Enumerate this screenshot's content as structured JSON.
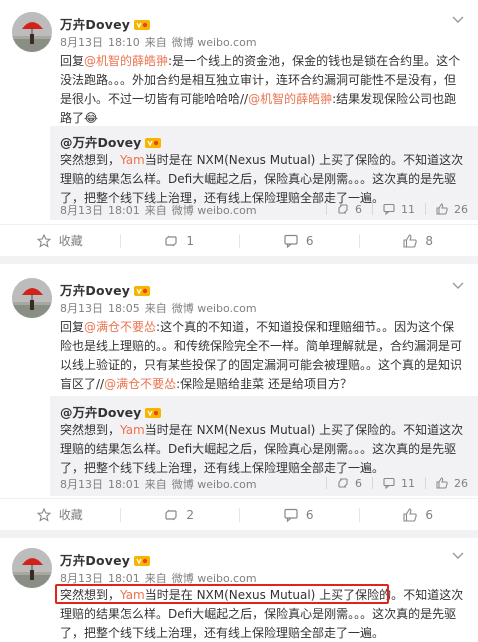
{
  "posts": [
    {
      "user": {
        "name": "万卉Dovey"
      },
      "meta": {
        "date": "8月13日",
        "time": "18:10",
        "source_prefix": "来自",
        "source": "微博 weibo.com"
      },
      "text": {
        "p1": "回复",
        "m1": "@机智的薛皓翀",
        "p2": ":是一个线上的资金池，保金的钱也是锁在合约里。这个没法跑路。。。外加合约是相互独立审计，连环合约漏洞可能性不是没有，但是很小。不过一切皆有可能哈哈哈//",
        "m2": "@机智的薛皓翀",
        "p3": ":结果发现保险公司也跑路了😂"
      },
      "quote": {
        "author": "@万卉Dovey",
        "t1": "突然想到，",
        "hl": "Yam",
        "t2": "当时是在 NXM(Nexus Mutual) 上买了保险的。不知道这次理赔的结果怎么样。Defi大崛起之后，保险真心是刚需。。。这次真的是先驱了，把整个线下线上治理，还有线上保险理赔全部走了一遍。",
        "date": "8月13日",
        "time": "18:01",
        "source_prefix": "来自",
        "source": "微博 weibo.com",
        "reposts": "6",
        "comments": "11",
        "likes": "26"
      },
      "actions": {
        "favorite": "收藏",
        "repost": "1",
        "comment": "6",
        "like": "8"
      }
    },
    {
      "user": {
        "name": "万卉Dovey"
      },
      "meta": {
        "date": "8月13日",
        "time": "18:05",
        "source_prefix": "来自",
        "source": "微博 weibo.com"
      },
      "text": {
        "p1": "回复",
        "m1": "@满仓不要怂",
        "p2": ":这个真的不知道，不知道投保和理赔细节。。因为这个保险也是线上理赔的。。和传统保险完全不一样。简单理解就是，合约漏洞是可以线上验证的，只有某些投保了的固定漏洞可能会被理赔。。这个真的是知识盲区了//",
        "m2": "@满仓不要怂",
        "p3": ":保险是赔给韭菜 还是给项目方？"
      },
      "quote": {
        "author": "@万卉Dovey",
        "t1": "突然想到，",
        "hl": "Yam",
        "t2": "当时是在 NXM(Nexus Mutual) 上买了保险的。不知道这次理赔的结果怎么样。Defi大崛起之后，保险真心是刚需。。。这次真的是先驱了，把整个线下线上治理，还有线上保险理赔全部走了一遍。",
        "date": "8月13日",
        "time": "18:01",
        "source_prefix": "来自",
        "source": "微博 weibo.com",
        "reposts": "6",
        "comments": "11",
        "likes": "26"
      },
      "actions": {
        "favorite": "收藏",
        "repost": "2",
        "comment": "6",
        "like": "6"
      }
    },
    {
      "user": {
        "name": "万卉Dovey"
      },
      "meta": {
        "date": "8月13日",
        "time": "18:01",
        "source_prefix": "来自",
        "source": "微博 weibo.com"
      },
      "text": {
        "t1": "突然想到，",
        "hl": "Yam",
        "t2": "当时是在 NXM(Nexus Mutual) 上买了保险的。",
        "t3": "不知道这次理赔的结果怎么样。Defi大崛起之后，保险真心是刚需。。。这次真的是先驱了，把整个线下线上治理，还有线上保险理赔全部走了一遍。"
      }
    }
  ],
  "colors": {
    "accent": "#eb7350",
    "highlight_box": "#e0241c",
    "muted": "#808080"
  }
}
